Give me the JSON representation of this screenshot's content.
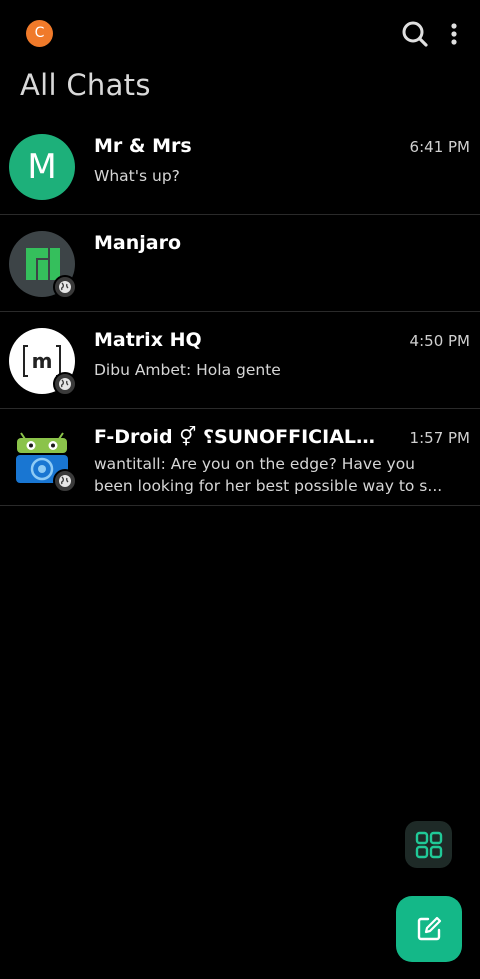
{
  "header": {
    "user_initial": "C",
    "user_color": "#f07a2a",
    "search_icon": "search-icon",
    "more_icon": "more-vertical-icon"
  },
  "page_title": "All Chats",
  "chats": [
    {
      "name": "Mr & Mrs",
      "time": "6:41 PM",
      "message": "What's up?",
      "avatar": {
        "type": "letter",
        "letter": "M",
        "color": "#1db07a"
      },
      "public_badge": false
    },
    {
      "name": "Manjaro",
      "time": "",
      "message": "",
      "avatar": {
        "type": "logo",
        "icon": "manjaro-logo-icon",
        "color": "#35bf5c"
      },
      "public_badge": true
    },
    {
      "name": "Matrix HQ",
      "time": "4:50 PM",
      "sender": "Dibu Ambet:",
      "message": "Hola gente",
      "avatar": {
        "type": "logo",
        "icon": "matrix-logo-icon",
        "color": "#ffffff"
      },
      "public_badge": true
    },
    {
      "name": "F-Droid ⚥ ⸮SUNOFFICIAL⸮ ...",
      "time": "1:57 PM",
      "sender": "wantitall:",
      "message_line1": "Are you on the edge? Have you",
      "message_line2": "been looking for her best possible way to s...",
      "avatar": {
        "type": "logo",
        "icon": "fdroid-logo-icon",
        "color": "#1976d2"
      },
      "public_badge": true
    }
  ],
  "actions": {
    "grid_icon": "grid-icon",
    "compose_icon": "compose-icon",
    "accent": "#14b888"
  }
}
